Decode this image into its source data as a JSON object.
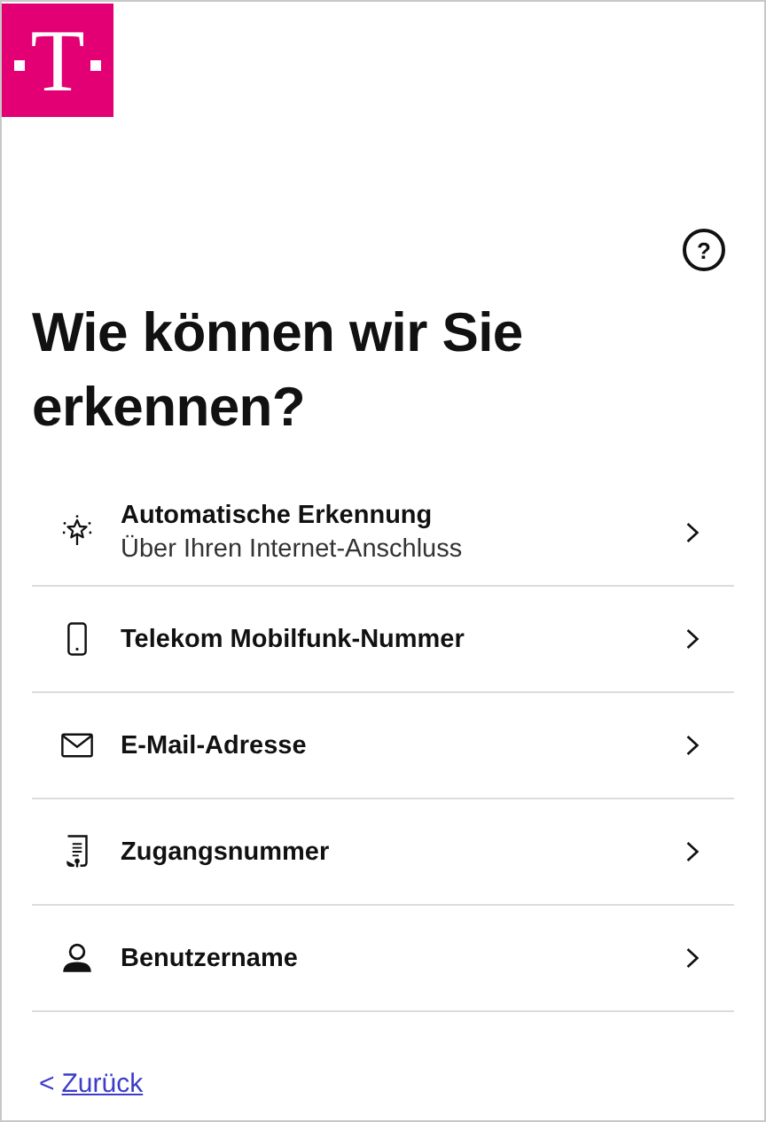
{
  "logo": {
    "letter": "T"
  },
  "help": {
    "label": "?"
  },
  "title": "Wie können wir Sie erkennen?",
  "options": [
    {
      "kind": "spark",
      "title": "Automatische Erkennung",
      "subtitle": "Über Ihren Internet-Anschluss"
    },
    {
      "kind": "phone",
      "title": "Telekom Mobilfunk-Nummer"
    },
    {
      "kind": "mail",
      "title": "E-Mail-Adresse"
    },
    {
      "kind": "document",
      "title": "Zugangsnummer"
    },
    {
      "kind": "person",
      "title": "Benutzername"
    }
  ],
  "back": {
    "chevron": "<",
    "label": "Zurück"
  }
}
